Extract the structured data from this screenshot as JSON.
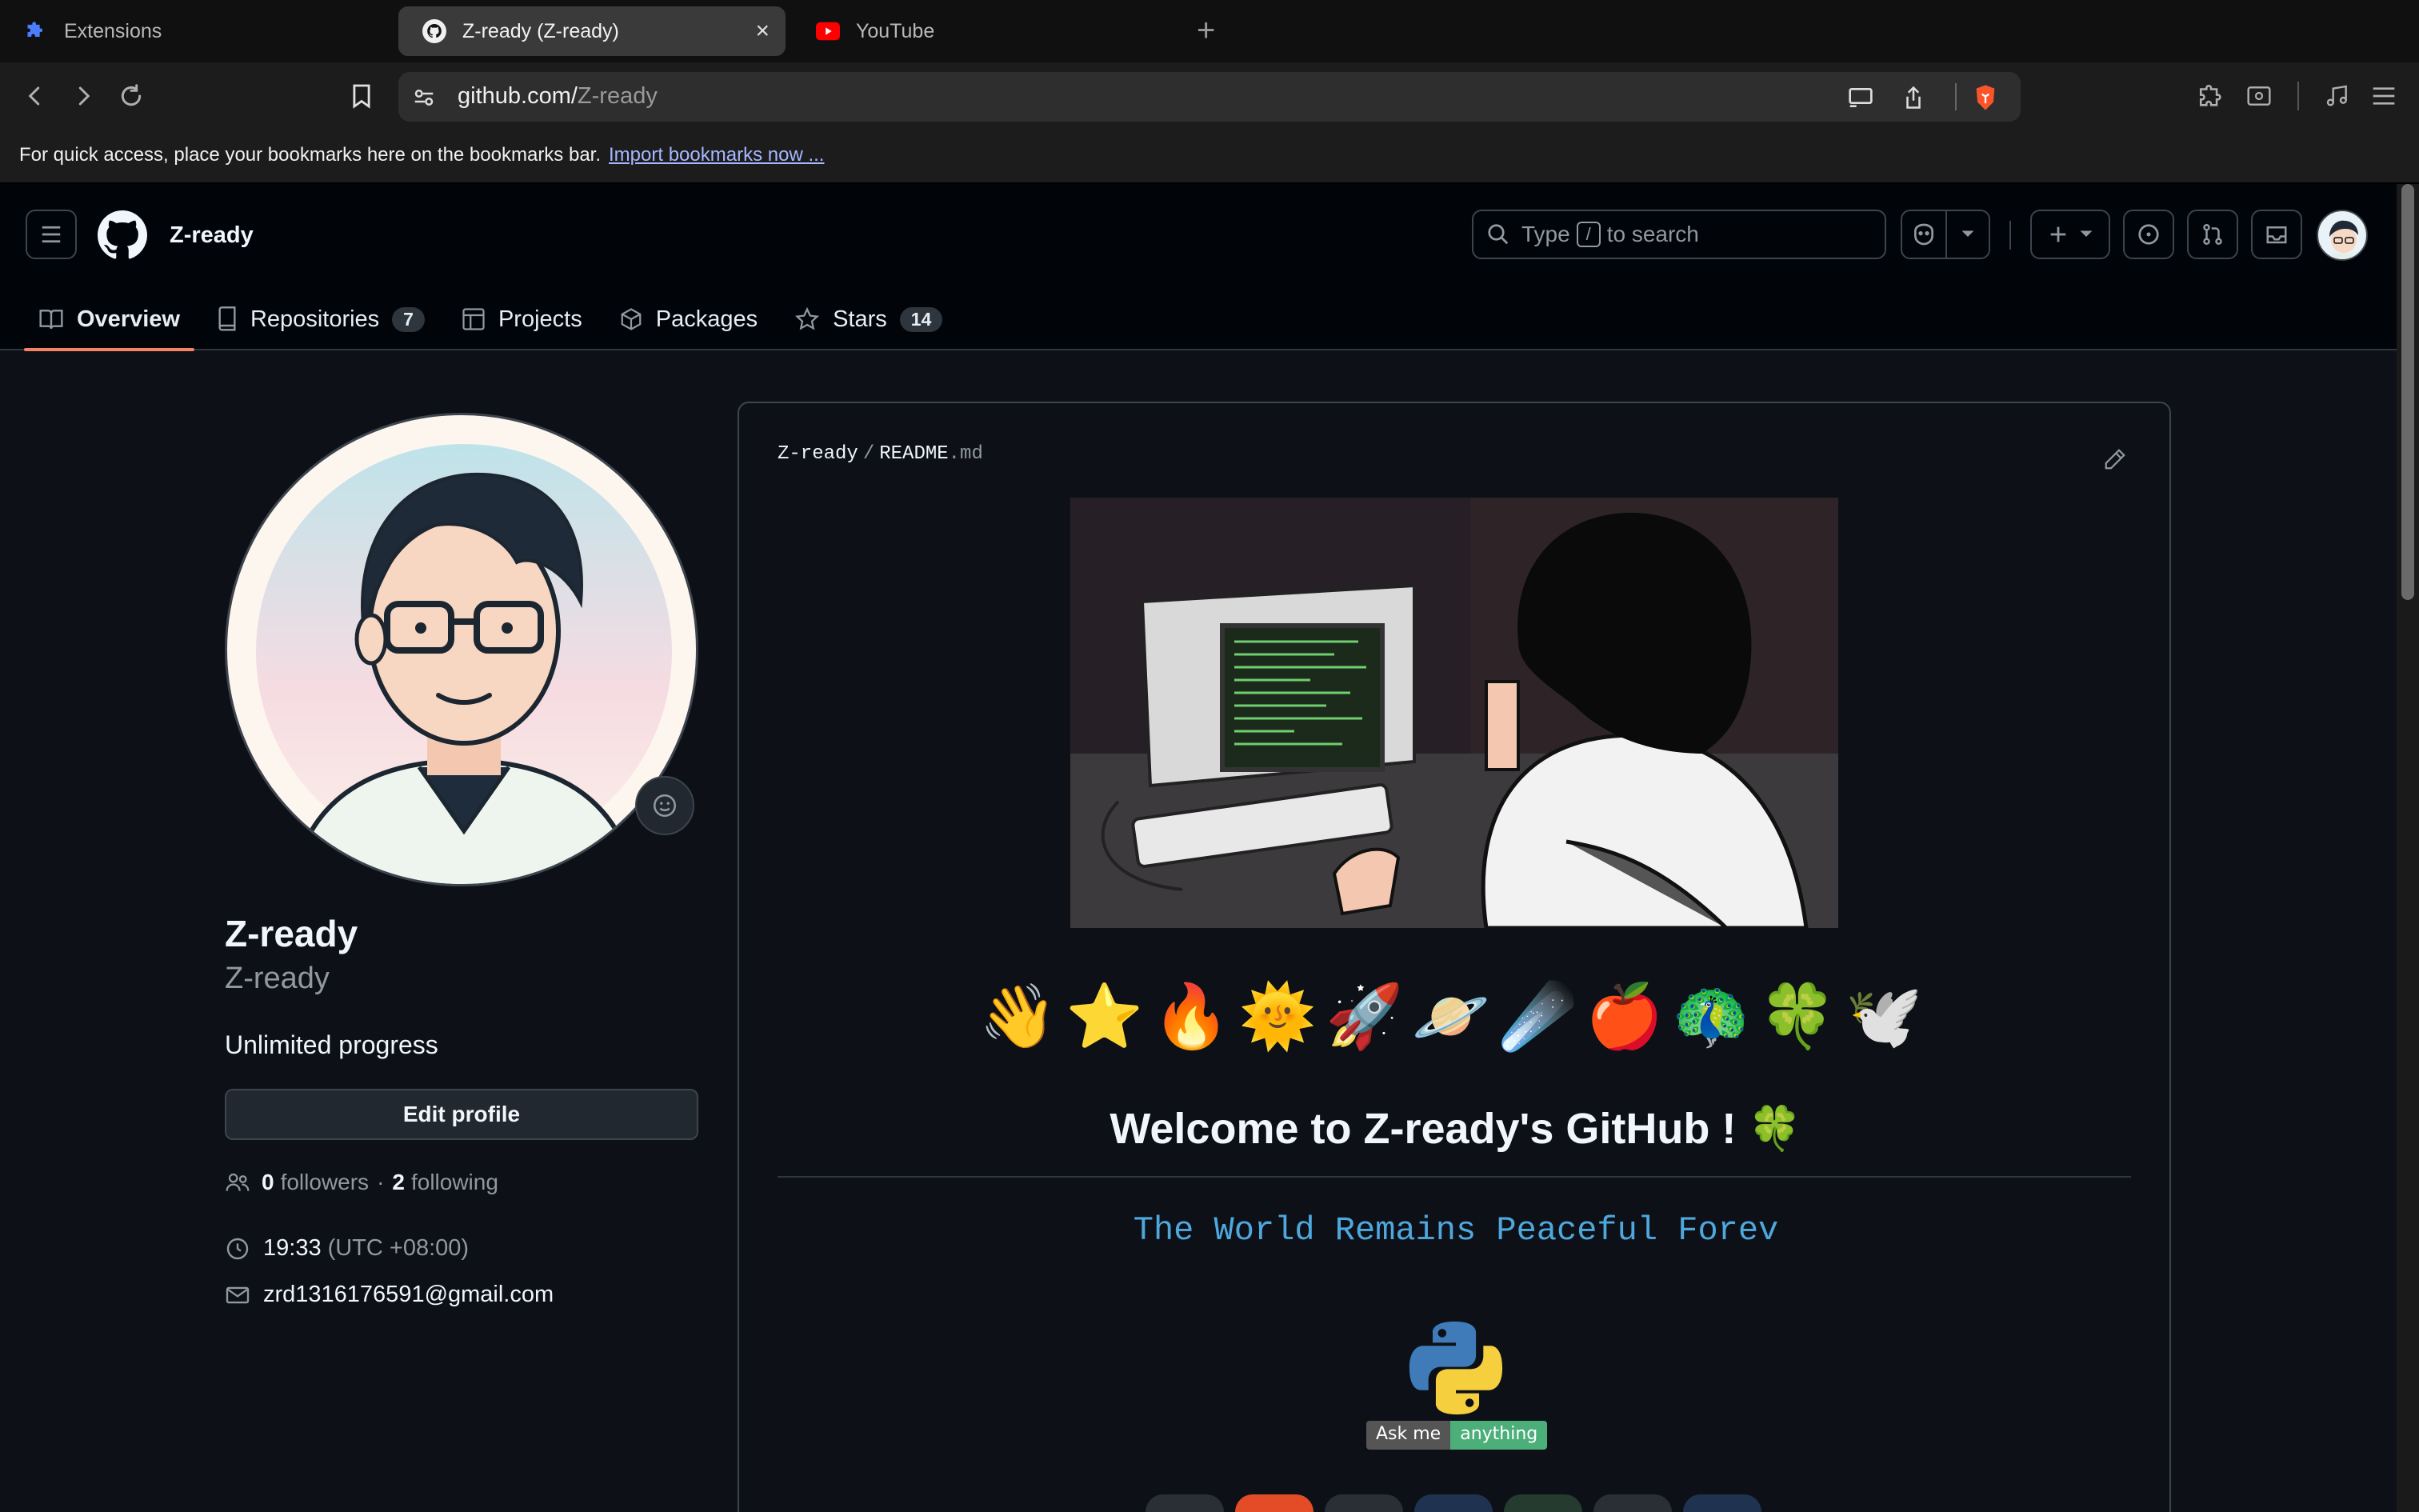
{
  "browser": {
    "tabs": [
      {
        "label": "Extensions",
        "favicon": "puzzle-icon",
        "active": false
      },
      {
        "label": "Z-ready (Z-ready)",
        "favicon": "github-icon",
        "active": true
      },
      {
        "label": "YouTube",
        "favicon": "youtube-icon",
        "active": false
      }
    ],
    "url_host": "github.com/",
    "url_path": "Z-ready",
    "bookmarks_hint": "For quick access, place your bookmarks here on the bookmarks bar.",
    "bookmarks_link": "Import bookmarks now ...",
    "accent_brave": "#fb542b"
  },
  "header": {
    "username": "Z-ready",
    "search_prefix": "Type",
    "search_key": "/",
    "search_suffix": "to search",
    "tabs": [
      {
        "label": "Overview",
        "icon": "book-icon",
        "selected": true
      },
      {
        "label": "Repositories",
        "icon": "repo-icon",
        "count": "7"
      },
      {
        "label": "Projects",
        "icon": "table-icon"
      },
      {
        "label": "Packages",
        "icon": "package-icon"
      },
      {
        "label": "Stars",
        "icon": "star-icon",
        "count": "14"
      }
    ]
  },
  "profile": {
    "name": "Z-ready",
    "login": "Z-ready",
    "bio": "Unlimited progress",
    "edit_label": "Edit profile",
    "followers": "0",
    "followers_label": "followers",
    "following": "2",
    "following_label": "following",
    "time": "19:33",
    "timezone": "(UTC +08:00)",
    "email": "zrd1316176591@gmail.com"
  },
  "readme": {
    "owner": "Z-ready",
    "filename": "README",
    "ext": ".md",
    "emojis": [
      "👋",
      "⭐",
      "🔥",
      "🌞",
      "🚀",
      "🪐",
      "☄️",
      "🍎",
      "🦚",
      "🍀",
      "🕊️"
    ],
    "welcome": "Welcome to Z-ready's GitHub ! 🍀",
    "typing_line": "The World Remains Peaceful Forev",
    "badge_left": "Ask me",
    "badge_right": "anything",
    "colors": {
      "link": "#4ea8de",
      "badge_green": "#4caf7a",
      "tab_underline": "#f78166"
    }
  }
}
